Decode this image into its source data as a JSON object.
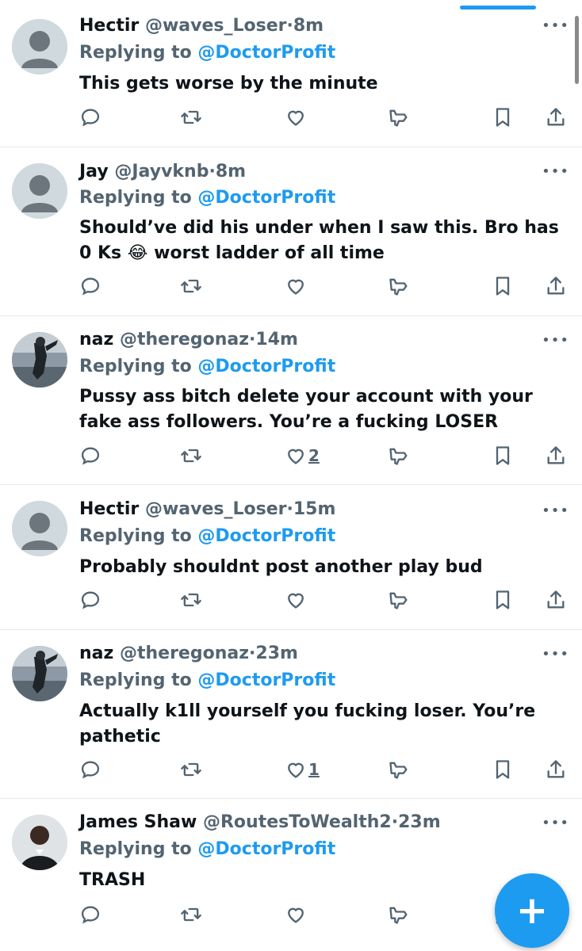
{
  "replies": [
    {
      "name": "Hectir",
      "handle": "@waves_Loser",
      "time": "8m",
      "replying_label": "Replying to",
      "replying_to": "@DoctorProfit",
      "text": "This gets worse by the minute",
      "likes": "",
      "avatar": "default"
    },
    {
      "name": "Jay",
      "handle": "@Jayvknb",
      "time": "8m",
      "replying_label": "Replying to",
      "replying_to": "@DoctorProfit",
      "text": "Should’ve did his under when I saw this. Bro has 0 Ks 😂 worst ladder of all time",
      "likes": "",
      "avatar": "default"
    },
    {
      "name": "naz",
      "handle": "@theregonaz",
      "time": "14m",
      "replying_label": "Replying to",
      "replying_to": "@DoctorProfit",
      "text": "Pussy ass bitch delete your account with your fake ass followers. You’re a fucking LOSER",
      "likes": "2",
      "avatar": "photo-sports"
    },
    {
      "name": "Hectir",
      "handle": "@waves_Loser",
      "time": "15m",
      "replying_label": "Replying to",
      "replying_to": "@DoctorProfit",
      "text": "Probably shouldnt post another play bud",
      "likes": "",
      "avatar": "default"
    },
    {
      "name": "naz",
      "handle": "@theregonaz",
      "time": "23m",
      "replying_label": "Replying to",
      "replying_to": "@DoctorProfit",
      "text": "Actually k1ll yourself you fucking loser. You’re pathetic",
      "likes": "1",
      "avatar": "photo-sports"
    },
    {
      "name": "James Shaw",
      "handle": "@RoutesToWealth2",
      "time": "23m",
      "replying_label": "Replying to",
      "replying_to": "@DoctorProfit",
      "text": "TRASH",
      "likes": "",
      "avatar": "photo-person"
    }
  ],
  "separator": "·",
  "more_icon": "more-horizontal-icon",
  "icons": {
    "reply": "reply-icon",
    "retweet": "retweet-icon",
    "like": "heart-icon",
    "views": "analytics-icon",
    "bookmark": "bookmark-icon",
    "share": "share-icon",
    "compose": "plus-icon"
  },
  "compose_label": "+",
  "colors": {
    "accent": "#1d9bf0",
    "secondary_text": "#536471",
    "primary_text": "#0f1419",
    "divider": "#e7e9ea"
  }
}
